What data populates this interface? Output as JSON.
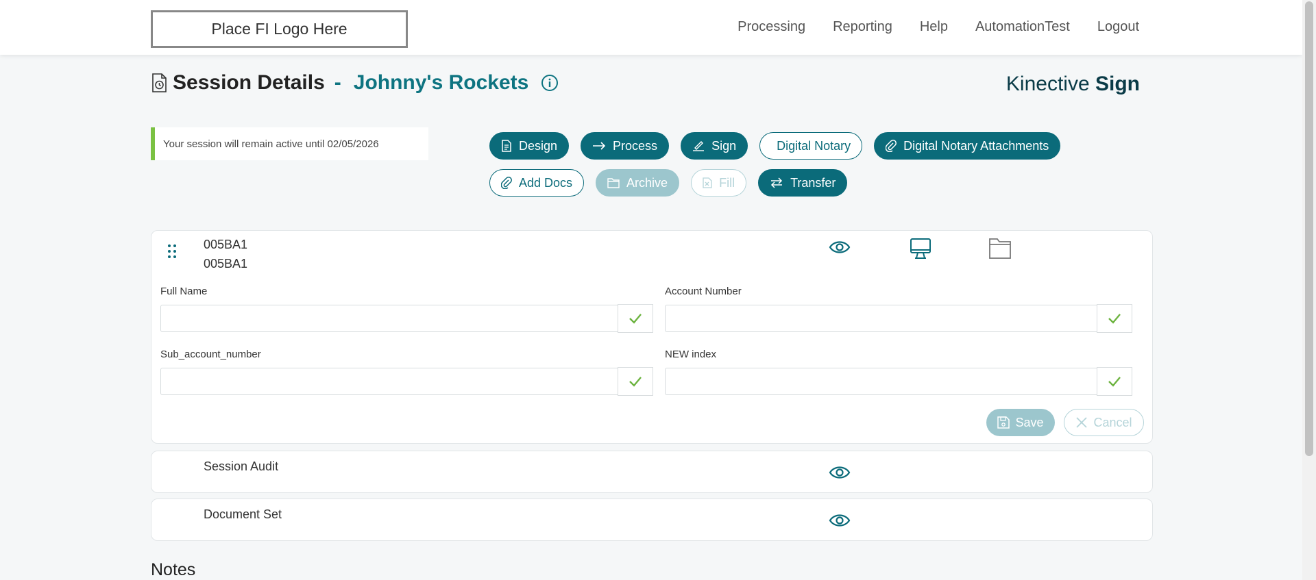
{
  "header": {
    "logo_text": "Place FI Logo Here",
    "nav": [
      "Processing",
      "Reporting",
      "Help",
      "AutomationTest",
      "Logout"
    ]
  },
  "page": {
    "title": "Session Details",
    "separator": "-",
    "session_name": "Johnny's Rockets",
    "brand_light": "Kinective ",
    "brand_bold": "Sign",
    "notice": "Your session will remain active until 02/05/2026"
  },
  "actions": {
    "design": "Design",
    "process": "Process",
    "sign": "Sign",
    "digital_notary": "Digital Notary",
    "digital_notary_attachments": "Digital Notary Attachments",
    "add_docs": "Add Docs",
    "archive": "Archive",
    "fill": "Fill",
    "transfer": "Transfer"
  },
  "document": {
    "id_line1": "005BA1",
    "id_line2": "005BA1",
    "fields": [
      {
        "label": "Full Name",
        "value": ""
      },
      {
        "label": "Account Number",
        "value": ""
      },
      {
        "label": "Sub_account_number",
        "value": ""
      },
      {
        "label": "NEW index",
        "value": ""
      }
    ],
    "save_label": "Save",
    "cancel_label": "Cancel"
  },
  "sections": {
    "session_audit": "Session Audit",
    "document_set": "Document Set",
    "notes": "Notes"
  },
  "colors": {
    "accent": "#0b6b7a",
    "title_accent": "#0e7481",
    "success": "#7ac142",
    "disabled": "#9cc6cd"
  },
  "icons": [
    "history-document-icon",
    "info-icon",
    "design-icon",
    "arrow-right-icon",
    "pen-icon",
    "paperclip-icon",
    "folder-icon",
    "fill-icon",
    "transfer-icon",
    "drag-handle-icon",
    "eye-icon",
    "monitor-icon",
    "checkmark-icon",
    "save-icon",
    "close-icon"
  ]
}
